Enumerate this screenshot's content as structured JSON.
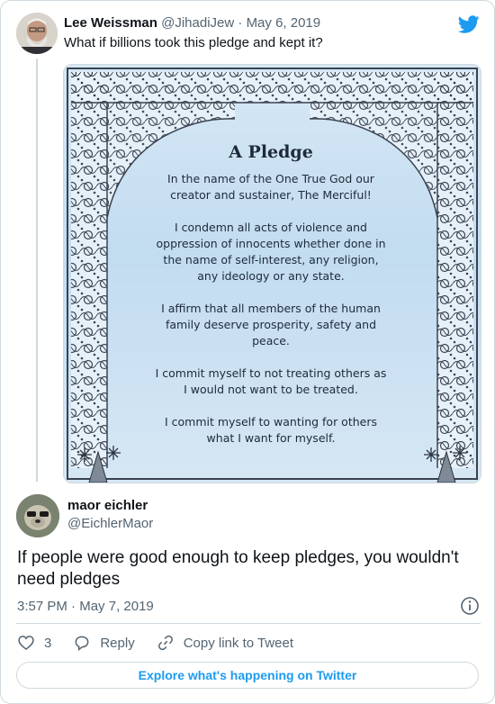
{
  "parent_tweet": {
    "author_name": "Lee Weissman",
    "handle": "@JihadiJew",
    "separator": "·",
    "date": "May 6, 2019",
    "text": "What if billions took this pledge and kept it?"
  },
  "pledge_image": {
    "title": "A Pledge",
    "paragraphs": [
      "In the name of the One True God our creator and sustainer, The Merciful!",
      "I condemn all acts of violence and oppression of innocents whether done in the name of self-interest, any religion, any ideology or any state.",
      "I affirm that all members of the human family deserve prosperity, safety and peace.",
      "I commit myself to not treating others as I would not want to be treated.",
      "I commit myself to wanting for others what I want for myself."
    ]
  },
  "main_tweet": {
    "author_name": "maor eichler",
    "handle": "@EichlerMaor",
    "text": "If people were good enough to keep pledges, you wouldn't need pledges",
    "time": "3:57 PM",
    "separator": "·",
    "date": "May 7, 2019"
  },
  "actions": {
    "like_count": "3",
    "reply_label": "Reply",
    "copy_link_label": "Copy link to Tweet"
  },
  "explore_button": "Explore what's happening on Twitter",
  "icons": {
    "logo": "twitter-bird-icon",
    "info": "info-icon",
    "like": "heart-icon",
    "reply": "reply-bubble-icon",
    "copy": "link-icon"
  },
  "colors": {
    "accent": "#1d9bf0",
    "muted": "#536471",
    "border": "#cfd9de"
  }
}
